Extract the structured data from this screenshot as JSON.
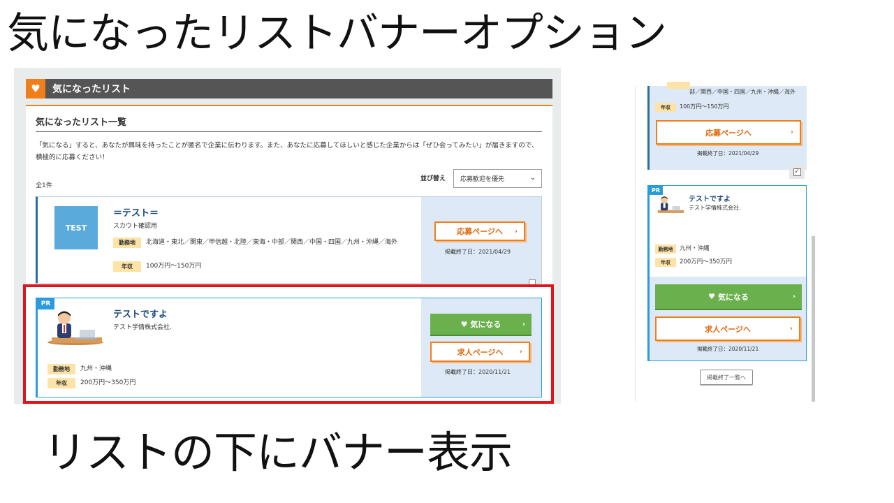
{
  "slide": {
    "title": "気になったリストバナーオプション",
    "caption": "リストの下にバナー表示"
  },
  "desktop": {
    "header_title": "気になったリスト",
    "list_title": "気になったリスト一覧",
    "description": "「気になる」すると、あなたが興味を持ったことが匿名で企業に伝わります。また、あなたに応募してほしいと感じた企業からは「ぜひ会ってみたい」が届きますので、積極的に応募ください！",
    "count": "全1件",
    "sort_label": "並び替え",
    "sort_value": "応募歓迎を優先",
    "job1": {
      "thumb_text": "TEST",
      "title": "＝テスト＝",
      "subtitle": "スカウト確認用",
      "location_tag": "勤務地",
      "location": "北海道・東北／関東／甲信越・北陸／東海・中部／関西／中国・四国／九州・沖縄／海外",
      "salary_tag": "年収",
      "salary": "100万円～150万円",
      "button": "応募ページへ",
      "end_date": "掲載終了日：2021/04/29"
    },
    "job2": {
      "badge": "PR",
      "title": "テストですよ",
      "company": "テスト学情株式会社.",
      "location_tag": "勤務地",
      "location": "九州・沖縄",
      "salary_tag": "年収",
      "salary": "200万円～350万円",
      "like_button": "気になる",
      "apply_button": "求人ページへ",
      "end_date": "掲載終了日：2020/11/21"
    }
  },
  "mobile": {
    "card1": {
      "location_tail": "部／関西／中国・四国／九州・沖縄／海外",
      "salary_tag": "年収",
      "salary": "100万円～150万円",
      "button": "応募ページへ",
      "end_date": "掲載終了日：2021/04/29"
    },
    "card2": {
      "badge": "PR",
      "title": "テストですよ",
      "company": "テスト学情株式会社.",
      "location_tag": "勤務地",
      "location": "九州・沖縄",
      "salary_tag": "年収",
      "salary": "200万円～350万円",
      "like_button": "気になる",
      "apply_button": "求人ページへ",
      "end_date": "掲載終了日：2020/11/21"
    },
    "ended_list_button": "掲載終了一覧へ"
  },
  "colors": {
    "accent_orange": "#f07f1a",
    "pr_blue": "#2b9be0",
    "green": "#6ab04c",
    "highlight_red": "#e0151b"
  }
}
